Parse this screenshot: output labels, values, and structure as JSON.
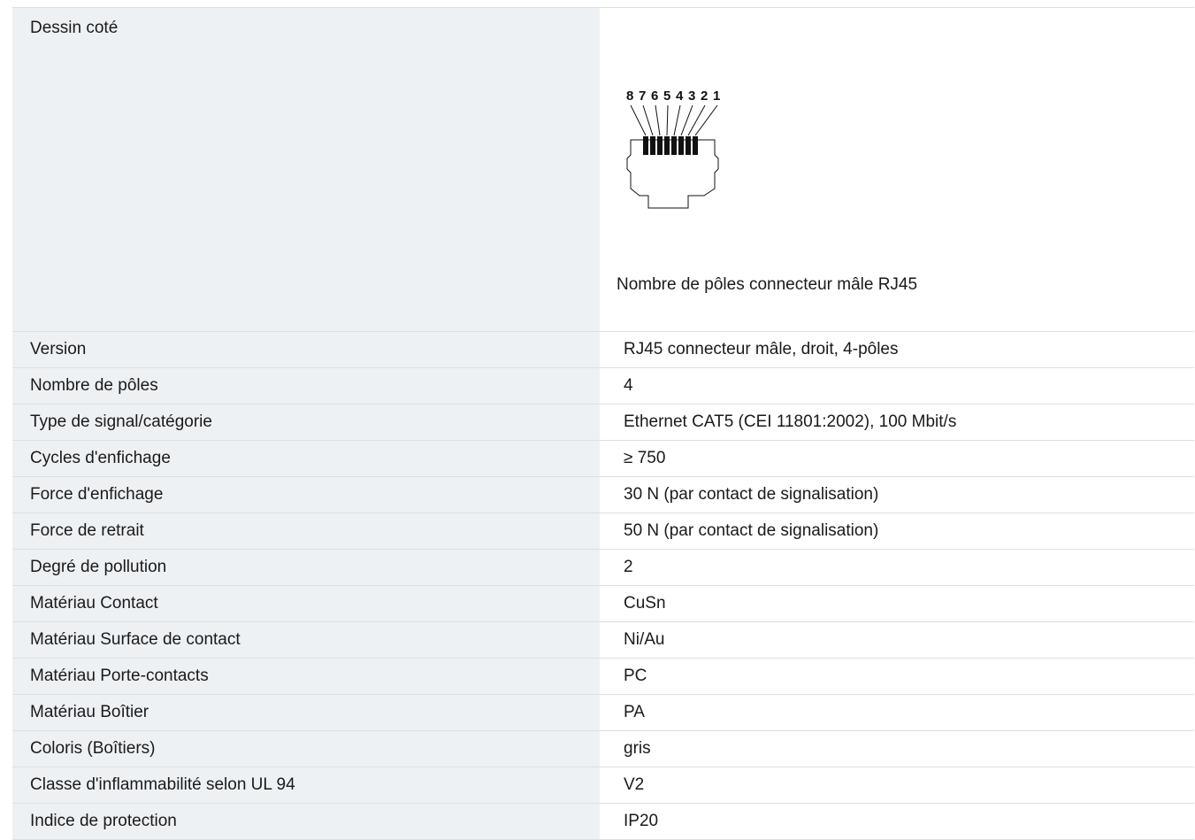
{
  "drawing": {
    "label": "Dessin coté",
    "pin_numbers": [
      "8",
      "7",
      "6",
      "5",
      "4",
      "3",
      "2",
      "1"
    ],
    "caption": "Nombre de pôles connecteur mâle RJ45",
    "icon": "rj45-connector-drawing"
  },
  "specs": [
    {
      "label": "Version",
      "value": "RJ45 connecteur mâle, droit, 4-pôles"
    },
    {
      "label": "Nombre de pôles",
      "value": "4"
    },
    {
      "label": "Type de signal/catégorie",
      "value": "Ethernet CAT5 (CEI 11801:2002), 100 Mbit/s"
    },
    {
      "label": "Cycles d'enfichage",
      "value": "≥ 750"
    },
    {
      "label": "Force d'enfichage",
      "value": "30 N (par contact de signalisation)"
    },
    {
      "label": "Force de retrait",
      "value": "50 N (par contact de signalisation)"
    },
    {
      "label": "Degré de pollution",
      "value": "2"
    },
    {
      "label": "Matériau Contact",
      "value": "CuSn"
    },
    {
      "label": "Matériau Surface de contact",
      "value": "Ni/Au"
    },
    {
      "label": "Matériau Porte-contacts",
      "value": "PC"
    },
    {
      "label": "Matériau Boîtier",
      "value": "PA"
    },
    {
      "label": "Coloris (Boîtiers)",
      "value": "gris"
    },
    {
      "label": "Classe d'inflammabilité selon UL 94",
      "value": "V2"
    },
    {
      "label": "Indice de protection",
      "value": "IP20"
    }
  ],
  "colors": {
    "label_background": "#eef1f4",
    "row_border": "#dcdfe3",
    "text": "#1a1a1a"
  }
}
